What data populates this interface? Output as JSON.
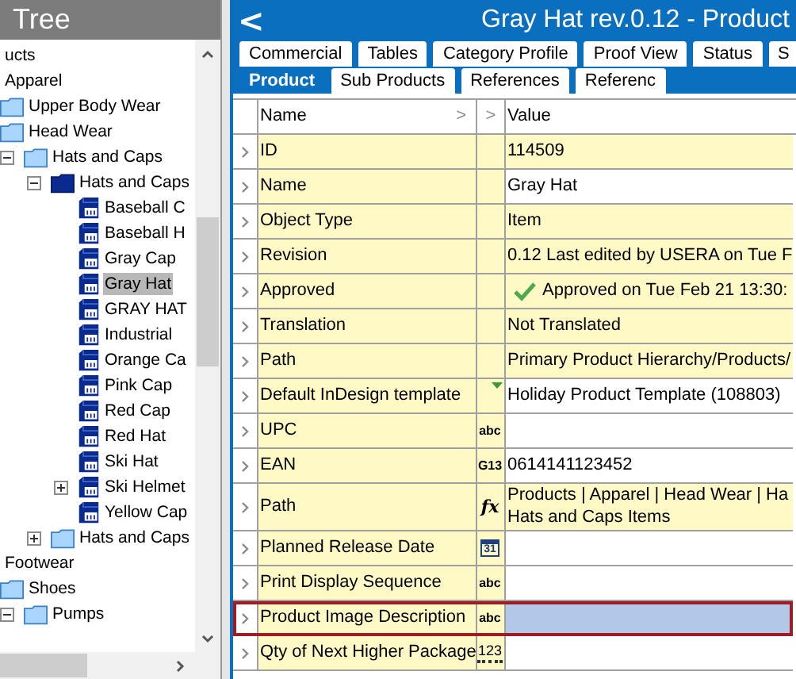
{
  "tree": {
    "title": "Tree",
    "items": [
      {
        "label": "ucts",
        "selected": false,
        "children": [
          {
            "label": "Apparel",
            "selected": false,
            "children": [
              {
                "label": "Upper Body Wear",
                "kind": "folder",
                "selected": false
              },
              {
                "label": "Head Wear",
                "kind": "folder",
                "selected": false,
                "children": [
                  {
                    "label": "Hats and Caps",
                    "kind": "folder",
                    "expanded": true,
                    "selected": false,
                    "children": [
                      {
                        "label": "Hats and Caps",
                        "kind": "dark-folder",
                        "expanded": true,
                        "selected": false,
                        "children": [
                          {
                            "label": "Baseball C",
                            "kind": "product",
                            "selected": false
                          },
                          {
                            "label": "Baseball H",
                            "kind": "product",
                            "selected": false
                          },
                          {
                            "label": "Gray Cap",
                            "kind": "product",
                            "selected": false
                          },
                          {
                            "label": "Gray Hat",
                            "kind": "product",
                            "selected": true
                          },
                          {
                            "label": "GRAY HAT",
                            "kind": "product",
                            "selected": false
                          },
                          {
                            "label": "Industrial",
                            "kind": "product",
                            "selected": false
                          },
                          {
                            "label": "Orange Ca",
                            "kind": "product",
                            "selected": false
                          },
                          {
                            "label": "Pink Cap",
                            "kind": "product",
                            "selected": false
                          },
                          {
                            "label": "Red Cap",
                            "kind": "product",
                            "selected": false
                          },
                          {
                            "label": "Red Hat",
                            "kind": "product",
                            "selected": false
                          },
                          {
                            "label": "Ski Hat",
                            "kind": "product",
                            "selected": false
                          },
                          {
                            "label": "Ski Helmet",
                            "kind": "product",
                            "expanded": false,
                            "selected": false
                          },
                          {
                            "label": "Yellow Cap",
                            "kind": "product",
                            "selected": false
                          }
                        ]
                      },
                      {
                        "label": "Hats and Caps",
                        "kind": "folder",
                        "expanded": false,
                        "selected": false
                      }
                    ]
                  }
                ]
              }
            ]
          },
          {
            "label": "Footwear",
            "selected": false,
            "children": [
              {
                "label": "Shoes",
                "kind": "folder",
                "selected": false,
                "children": [
                  {
                    "label": "Pumps",
                    "kind": "folder",
                    "expanded": true,
                    "selected": false
                  }
                ]
              }
            ]
          }
        ]
      }
    ]
  },
  "window": {
    "back": "<",
    "title": "Gray Hat rev.0.12 - Product"
  },
  "tabs_top": [
    {
      "label": "Commercial",
      "selected": false
    },
    {
      "label": "Tables",
      "selected": false
    },
    {
      "label": "Category Profile",
      "selected": false
    },
    {
      "label": "Proof View",
      "selected": false
    },
    {
      "label": "Status",
      "selected": false
    },
    {
      "label": "S",
      "selected": false
    }
  ],
  "tabs_bottom": [
    {
      "label": "Product",
      "selected": true
    },
    {
      "label": "Sub Products",
      "selected": false
    },
    {
      "label": "References",
      "selected": false
    },
    {
      "label": "Referenc",
      "selected": false
    }
  ],
  "table": {
    "columns": [
      "Name",
      ">",
      "Value"
    ],
    "name_arrow": ">",
    "rows": [
      {
        "name": "ID",
        "readonly": true,
        "selected": false,
        "value": [
          "114509"
        ]
      },
      {
        "name": "Name",
        "readonly": false,
        "selected": false,
        "value": [
          "Gray Hat"
        ]
      },
      {
        "name": "Object Type",
        "readonly": true,
        "selected": false,
        "value": [
          "Item"
        ]
      },
      {
        "name": "Revision",
        "readonly": true,
        "selected": false,
        "value": [
          "0.12 Last edited by USERA on Tue F"
        ]
      },
      {
        "name": "Approved",
        "readonly": true,
        "selected": false,
        "approved": true,
        "value": [
          "Approved on Tue Feb 21 13:30:"
        ]
      },
      {
        "name": "Translation",
        "readonly": true,
        "selected": false,
        "value": [
          "Not Translated"
        ]
      },
      {
        "name": "Path",
        "readonly": true,
        "selected": false,
        "value": [
          "Primary Product Hierarchy/Products/"
        ]
      },
      {
        "name": "Default InDesign template",
        "readonly": false,
        "selected": false,
        "type": {
          "kind": "dropdown"
        },
        "value": [
          "Holiday Product Template (108803)"
        ]
      },
      {
        "name": "UPC",
        "readonly": false,
        "selected": false,
        "type": {
          "kind": "text",
          "label": "abc"
        }
      },
      {
        "name": "EAN",
        "readonly": false,
        "selected": false,
        "type": {
          "kind": "text",
          "label": "G13"
        },
        "value": [
          "0614141123452"
        ]
      },
      {
        "name": "Path",
        "readonly": true,
        "selected": false,
        "type": {
          "kind": "formula",
          "label": "fx"
        },
        "value": [
          "Products | Apparel | Head Wear | Ha",
          "Hats and Caps Items"
        ]
      },
      {
        "name": "Planned Release Date",
        "readonly": false,
        "selected": false,
        "type": {
          "kind": "calendar",
          "label": "31"
        }
      },
      {
        "name": "Print Display Sequence",
        "readonly": false,
        "selected": false,
        "type": {
          "kind": "text",
          "label": "abc"
        }
      },
      {
        "name": "Product Image Description",
        "selected": true,
        "type": {
          "kind": "text",
          "label": "abc"
        }
      },
      {
        "name": "Qty of Next Higher Package",
        "readonly": false,
        "selected": false,
        "type": {
          "kind": "number",
          "label": "123"
        }
      }
    ]
  }
}
